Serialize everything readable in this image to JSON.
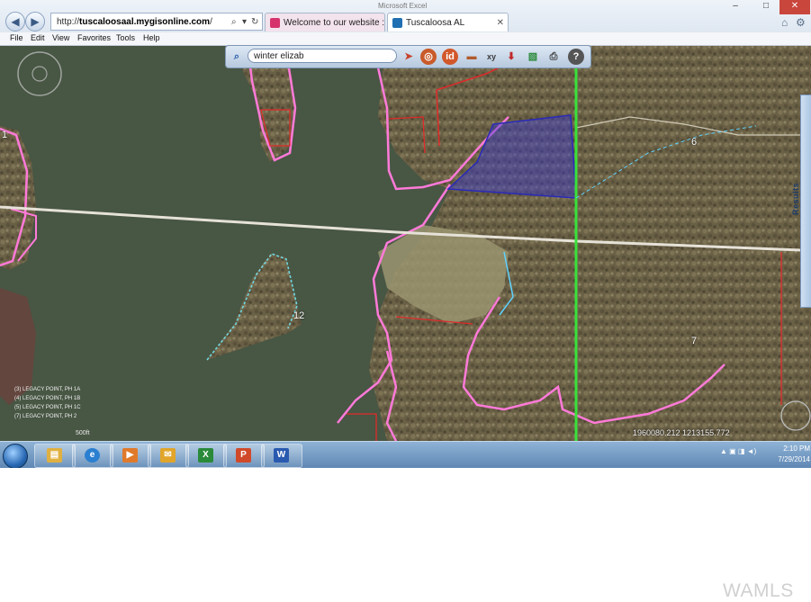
{
  "browser": {
    "address": {
      "prefix": "http://",
      "host": "tuscaloosaal.mygisonline.com",
      "suffix": "/"
    },
    "tabs": [
      {
        "label": "Welcome to our website : TUS...",
        "icon_color": "#d6336c"
      },
      {
        "label": "Tuscaloosa AL",
        "icon_color": "#1f6fb2"
      }
    ],
    "window_title": "Microsoft Excel",
    "menu": [
      "File",
      "Edit",
      "View",
      "Favorites",
      "Tools",
      "Help"
    ]
  },
  "gis": {
    "search_value": "winter elizab",
    "results_tab_label": "Results",
    "tool_icons": [
      "pointer-icon",
      "identify-target-icon",
      "id-icon",
      "measure-ruler-icon",
      "xy-coordinate-icon",
      "pin-icon",
      "layers-map-icon",
      "print-icon",
      "help-icon"
    ]
  },
  "map": {
    "parcel_labels": [
      {
        "id": "6",
        "text": "6"
      },
      {
        "id": "7",
        "text": "7"
      },
      {
        "id": "12",
        "text": "12"
      },
      {
        "id": "1",
        "text": "1"
      }
    ],
    "legend": [
      "(3) LEGACY POINT, PH 1A",
      "(4) LEGACY POINT, PH 1B",
      "(5) LEGACY POINT, PH 1C",
      "(7) LEGACY POINT, PH 2"
    ],
    "scale_text": "500ft",
    "coordinates": "1960080.212  1213155.772",
    "colors": {
      "water": "#485644",
      "forest": "#6b6248",
      "parcel_pink": "#ff7ad9",
      "parcel_red": "#e02a2a",
      "section_green": "#39e13a",
      "selection_blue": "#3a3ad0",
      "road": "#e6e2d8"
    }
  },
  "taskbar": {
    "apps": [
      "explorer-folder-icon",
      "internet-explorer-icon",
      "media-player-icon",
      "outlook-icon",
      "excel-icon",
      "powerpoint-icon",
      "word-icon"
    ],
    "time": "2:10 PM",
    "date": "7/29/2014"
  },
  "watermark": "WAMLS"
}
